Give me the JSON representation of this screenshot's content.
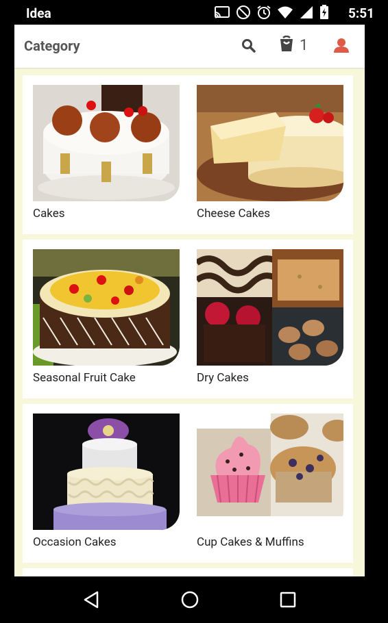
{
  "status_bar": {
    "carrier": "Idea",
    "time": "5:51",
    "icons": [
      "cast-icon",
      "do-not-disturb-icon",
      "alarm-icon",
      "wifi-icon",
      "cell-signal-icon",
      "battery-icon"
    ]
  },
  "toolbar": {
    "title": "Category",
    "cart_count": "1",
    "icons": [
      "search-icon",
      "cart-icon",
      "user-icon"
    ]
  },
  "categories": [
    {
      "label": "Cakes",
      "image": "cake-image"
    },
    {
      "label": "Cheese Cakes",
      "image": "cheese-cake-image"
    },
    {
      "label": "Seasonal Fruit Cake",
      "image": "fruit-cake-image"
    },
    {
      "label": "Dry Cakes",
      "image": "dry-cakes-image"
    },
    {
      "label": "Occasion Cakes",
      "image": "occasion-cake-image"
    },
    {
      "label": "Cup Cakes & Muffins",
      "image": "cupcakes-muffins-image"
    }
  ],
  "nav_bar": {
    "icons": [
      "back-icon",
      "home-icon",
      "recents-icon"
    ]
  },
  "colors": {
    "background": "#f7f7dc",
    "accent_user": "#e05a4a",
    "text": "#555555"
  }
}
